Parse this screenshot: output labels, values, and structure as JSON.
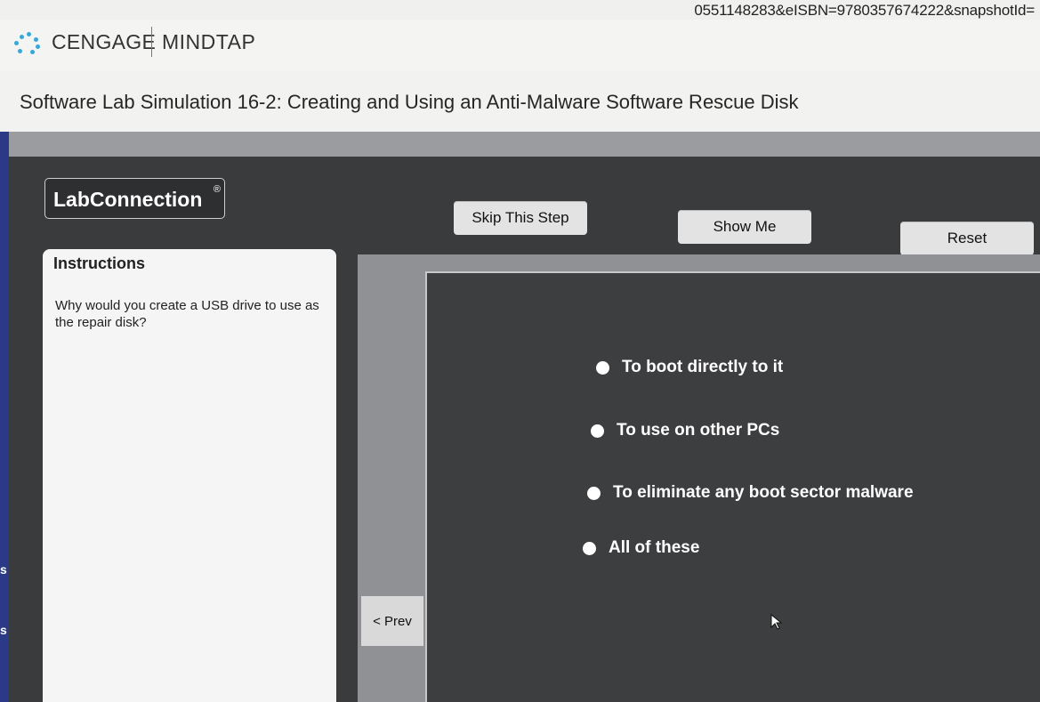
{
  "browser": {
    "url_fragment": "0551148283&eISBN=9780357674222&snapshotId="
  },
  "header": {
    "brand": "CENGAGE",
    "product": "MINDTAP",
    "logo_icon": "cengage-logo-icon"
  },
  "activity": {
    "title": "Software Lab Simulation 16-2: Creating and Using an Anti-Malware Software Rescue Disk"
  },
  "lab": {
    "brand": "LabConnection",
    "brand_mark": "®",
    "buttons": {
      "skip": "Skip This Step",
      "show_me": "Show Me",
      "reset": "Reset"
    },
    "instructions": {
      "heading": "Instructions",
      "text": "Why would you create a USB drive to use as the repair disk?"
    },
    "options": [
      "To boot directly to it",
      "To use on other PCs",
      "To eliminate any boot sector malware",
      "All of these"
    ],
    "prev_label": "< Prev"
  },
  "sidebar": {
    "fragments": [
      "s",
      "s"
    ]
  },
  "colors": {
    "lab_background": "#3a3b3d",
    "button_bg": "#e3e3e3",
    "accent_blue": "#2b3a86"
  }
}
